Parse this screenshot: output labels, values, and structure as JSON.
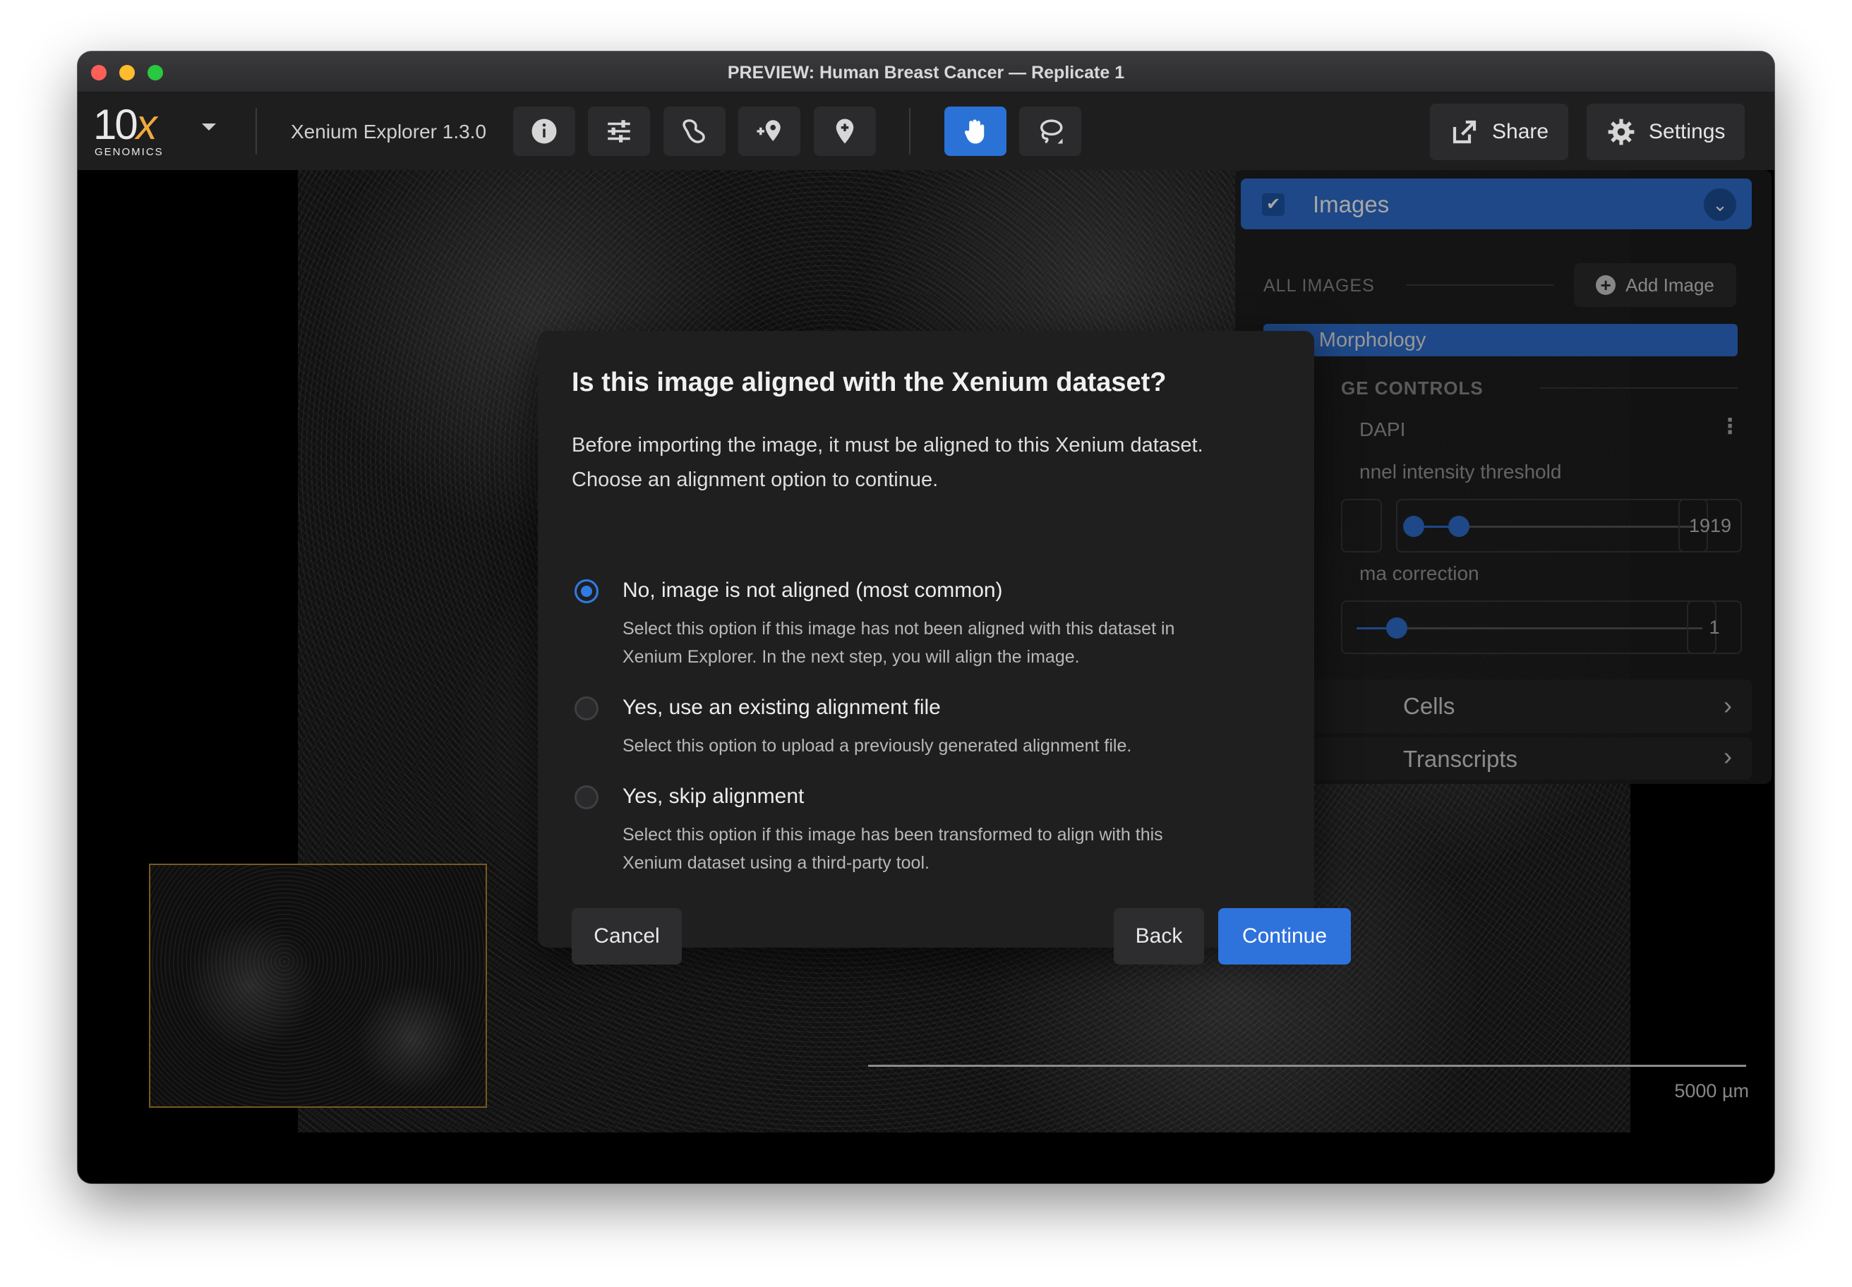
{
  "window": {
    "title": "PREVIEW: Human Breast Cancer — Replicate 1"
  },
  "toolbar": {
    "logo_text": "10x",
    "logo_subtext": "GENOMICS",
    "app_version": "Xenium Explorer 1.3.0",
    "share_label": "Share",
    "settings_label": "Settings"
  },
  "panel": {
    "header_title": "Images",
    "all_images_label": "ALL IMAGES",
    "add_image_label": "Add Image",
    "image_item": "ium Morphology",
    "controls_label": "GE CONTROLS",
    "channel_name": "DAPI",
    "intensity_label": "nnel intensity threshold",
    "intensity_max": "1919",
    "gamma_label": "ma correction",
    "gamma_value": "1",
    "cells_label": "Cells",
    "transcripts_label": "Transcripts"
  },
  "viewer": {
    "scale_label": "5000 µm"
  },
  "modal": {
    "title": "Is this image aligned with the Xenium dataset?",
    "description_line1": "Before importing the image, it must be aligned to this Xenium dataset.",
    "description_line2": "Choose an alignment option to continue.",
    "options": [
      {
        "label": "No, image is not aligned (most common)",
        "help_line1": "Select this option if this image has not been aligned with this dataset in",
        "help_line2": "Xenium Explorer. In the next step, you will align the image.",
        "selected": true
      },
      {
        "label": "Yes, use an existing alignment file",
        "help_line1": "Select this option to upload a previously generated alignment file.",
        "selected": false
      },
      {
        "label": "Yes, skip alignment",
        "help_line1": "Select this option if this image has been transformed to align with this",
        "help_line2": "Xenium dataset using a third-party tool.",
        "selected": false
      }
    ],
    "cancel_label": "Cancel",
    "back_label": "Back",
    "continue_label": "Continue"
  },
  "colors": {
    "accent": "#2e72dc",
    "background": "#000000",
    "panel": "#1e1e1f"
  },
  "icons": [
    "info-icon",
    "sliders-icon",
    "boundary-icon",
    "add-location-icon",
    "location-pin-icon",
    "hand-pan-icon",
    "lasso-icon",
    "share-icon",
    "gear-icon",
    "chevron-down-icon",
    "chevron-right-icon",
    "plus-circle-icon",
    "kebab-menu-icon"
  ]
}
